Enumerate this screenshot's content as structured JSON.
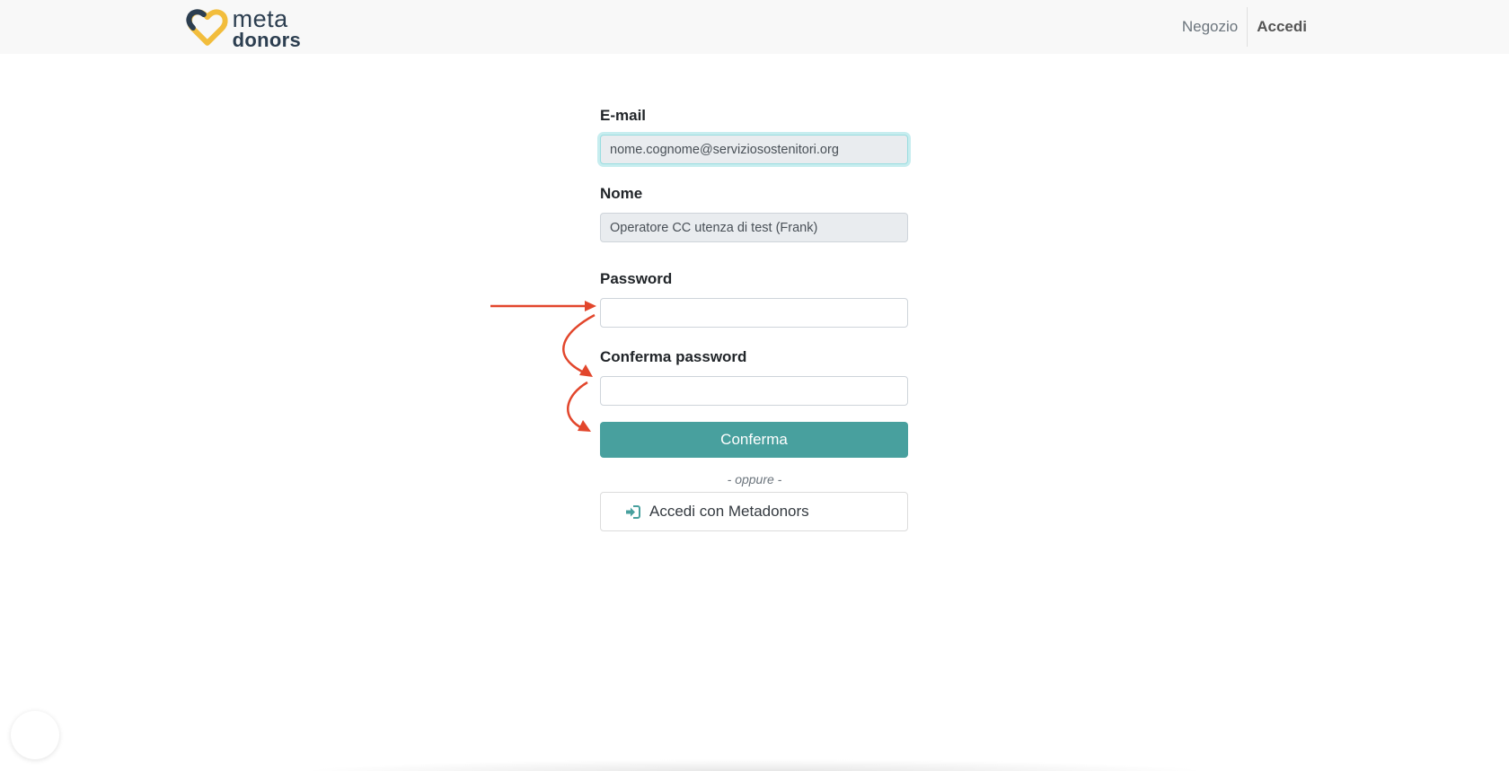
{
  "navbar": {
    "logo": {
      "line1": "meta",
      "line2": "donors",
      "icon": "heart-logo-icon"
    },
    "links": [
      {
        "label": "Negozio"
      },
      {
        "label": "Accedi"
      }
    ]
  },
  "form": {
    "email": {
      "label": "E-mail",
      "value": "nome.cognome@serviziosostenitori.org"
    },
    "nome": {
      "label": "Nome",
      "value": "Operatore CC utenza di test (Frank)"
    },
    "password": {
      "label": "Password",
      "value": ""
    },
    "confirm_password": {
      "label": "Conferma password",
      "value": ""
    },
    "submit_label": "Conferma",
    "separator": "- oppure -",
    "alt_login_label": "Accedi con Metadonors",
    "alt_login_icon": "sign-in-icon"
  },
  "colors": {
    "primary": "#48a09e",
    "annotation_arrow": "#e2462c",
    "logo_dark": "#2c3e50",
    "logo_yellow": "#f2bd3c"
  }
}
